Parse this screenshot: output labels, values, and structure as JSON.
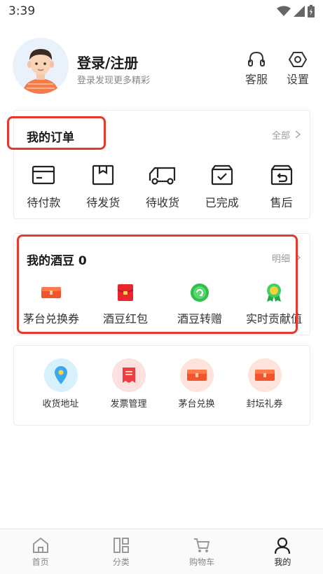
{
  "status_bar": {
    "time": "3:39"
  },
  "profile": {
    "title": "登录/注册",
    "subtitle": "登录发现更多精彩",
    "service_label": "客服",
    "settings_label": "设置"
  },
  "orders": {
    "title": "我的订单",
    "more_label": "全部",
    "items": [
      {
        "label": "待付款",
        "icon": "wallet-card-icon"
      },
      {
        "label": "待发货",
        "icon": "package-box-icon"
      },
      {
        "label": "待收货",
        "icon": "delivery-truck-icon"
      },
      {
        "label": "已完成",
        "icon": "check-box-icon"
      },
      {
        "label": "售后",
        "icon": "return-box-icon"
      }
    ]
  },
  "beans": {
    "title": "我的酒豆 0",
    "more_label": "明细",
    "items": [
      {
        "label": "茅台兑换券",
        "icon": "coupon-icon"
      },
      {
        "label": "酒豆红包",
        "icon": "red-envelope-icon"
      },
      {
        "label": "酒豆转赠",
        "icon": "transfer-icon"
      },
      {
        "label": "实时贡献值",
        "icon": "medal-icon"
      }
    ]
  },
  "services": {
    "items": [
      {
        "label": "收货地址",
        "icon": "location-pin-icon"
      },
      {
        "label": "发票管理",
        "icon": "invoice-icon"
      },
      {
        "label": "茅台兑换",
        "icon": "coupon-icon"
      },
      {
        "label": "封坛礼券",
        "icon": "coupon-icon"
      }
    ]
  },
  "tabbar": {
    "items": [
      {
        "label": "首页",
        "icon": "home-icon"
      },
      {
        "label": "分类",
        "icon": "category-icon"
      },
      {
        "label": "购物车",
        "icon": "cart-icon"
      },
      {
        "label": "我的",
        "icon": "person-icon",
        "active": true
      }
    ]
  },
  "colors": {
    "highlight_red": "#e23b2e",
    "coupon_orange": "#f2552c",
    "envelope_red": "#e8262b",
    "green": "#2fbf4a",
    "pin_blue": "#3aa7ee"
  }
}
